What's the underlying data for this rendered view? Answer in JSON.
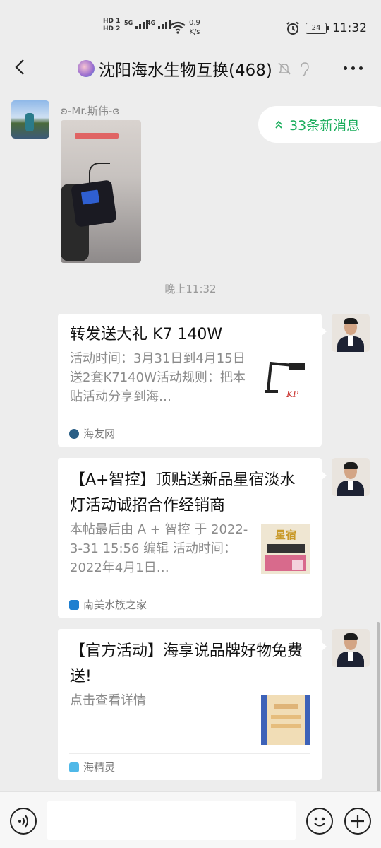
{
  "status_bar": {
    "hd_top": "HD 1",
    "hd_bottom": "HD 2",
    "net_1": "5G",
    "net_2": "4G",
    "speed_value": "0.9",
    "speed_unit": "K/s",
    "battery": "24",
    "time": "11:32"
  },
  "header": {
    "title": "沈阳海水生物互换(468)"
  },
  "new_messages": {
    "label": "33条新消息"
  },
  "messages": [
    {
      "type": "image",
      "sender": "ʚ-Mr.斯伟-ɞ"
    }
  ],
  "timestamp": "晚上11:32",
  "cards": [
    {
      "title": "转发送大礼 K7 140W",
      "desc": "活动时间：3月31日到4月15日送2套K7140W活动规则：把本贴活动分享到海…",
      "source": "海友网",
      "source_color": "#2b5f86"
    },
    {
      "title": "【A+智控】顶贴送新品星宿淡水灯活动诚招合作经销商",
      "desc": " 本帖最后由 A + 智控 于 2022-3-31 15:56 编辑 活动时间：2022年4月1日…",
      "source": "南美水族之家",
      "source_color": "#1e7fd0",
      "thumb_text": "星宿"
    },
    {
      "title": "【官方活动】海享说品牌好物免费送!",
      "desc": "点击查看详情",
      "source": "海精灵",
      "source_color": "#4fb8e8"
    }
  ]
}
